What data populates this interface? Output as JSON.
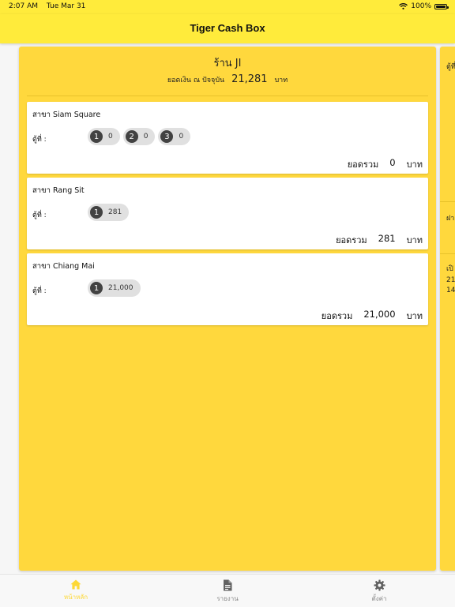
{
  "status_bar": {
    "time": "2:07 AM",
    "date": "Tue Mar 31",
    "battery": "100%"
  },
  "app": {
    "title": "Tiger Cash Box"
  },
  "shop": {
    "name": "ร้าน JI",
    "balance_label": "ยอดเงิน ณ ปัจจุบัน",
    "balance_value": "21,281",
    "currency": "บาท"
  },
  "branches": [
    {
      "name": "สาขา Siam Square",
      "box_label": "ตู้ที่ :",
      "boxes": [
        {
          "num": "1",
          "value": "0"
        },
        {
          "num": "2",
          "value": "0"
        },
        {
          "num": "3",
          "value": "0"
        }
      ],
      "total_label": "ยอดรวม",
      "total_value": "0",
      "currency": "บาท"
    },
    {
      "name": "สาขา Rang Sit",
      "box_label": "ตู้ที่ :",
      "boxes": [
        {
          "num": "1",
          "value": "281"
        }
      ],
      "total_label": "ยอดรวม",
      "total_value": "281",
      "currency": "บาท"
    },
    {
      "name": "สาขา Chiang Mai",
      "box_label": "ตู้ที่ :",
      "boxes": [
        {
          "num": "1",
          "value": "21,000"
        }
      ],
      "total_label": "ยอดรวม",
      "total_value": "21,000",
      "currency": "บาท"
    }
  ],
  "side_panel": {
    "frag1": "ตู้ที่",
    "frag2": "ฝา",
    "frag3": "เปิ",
    "frag4": "21",
    "frag5": "14"
  },
  "nav": [
    {
      "label": "หน้าหลัก",
      "icon": "home-icon",
      "active": true
    },
    {
      "label": "รายงาน",
      "icon": "document-icon",
      "active": false
    },
    {
      "label": "ตั้งค่า",
      "icon": "gear-icon",
      "active": false
    }
  ],
  "colors": {
    "app_bar": "#ffeb3b",
    "panel": "#ffd83d",
    "chip_badge": "#424242",
    "active_nav": "#fdd835"
  }
}
